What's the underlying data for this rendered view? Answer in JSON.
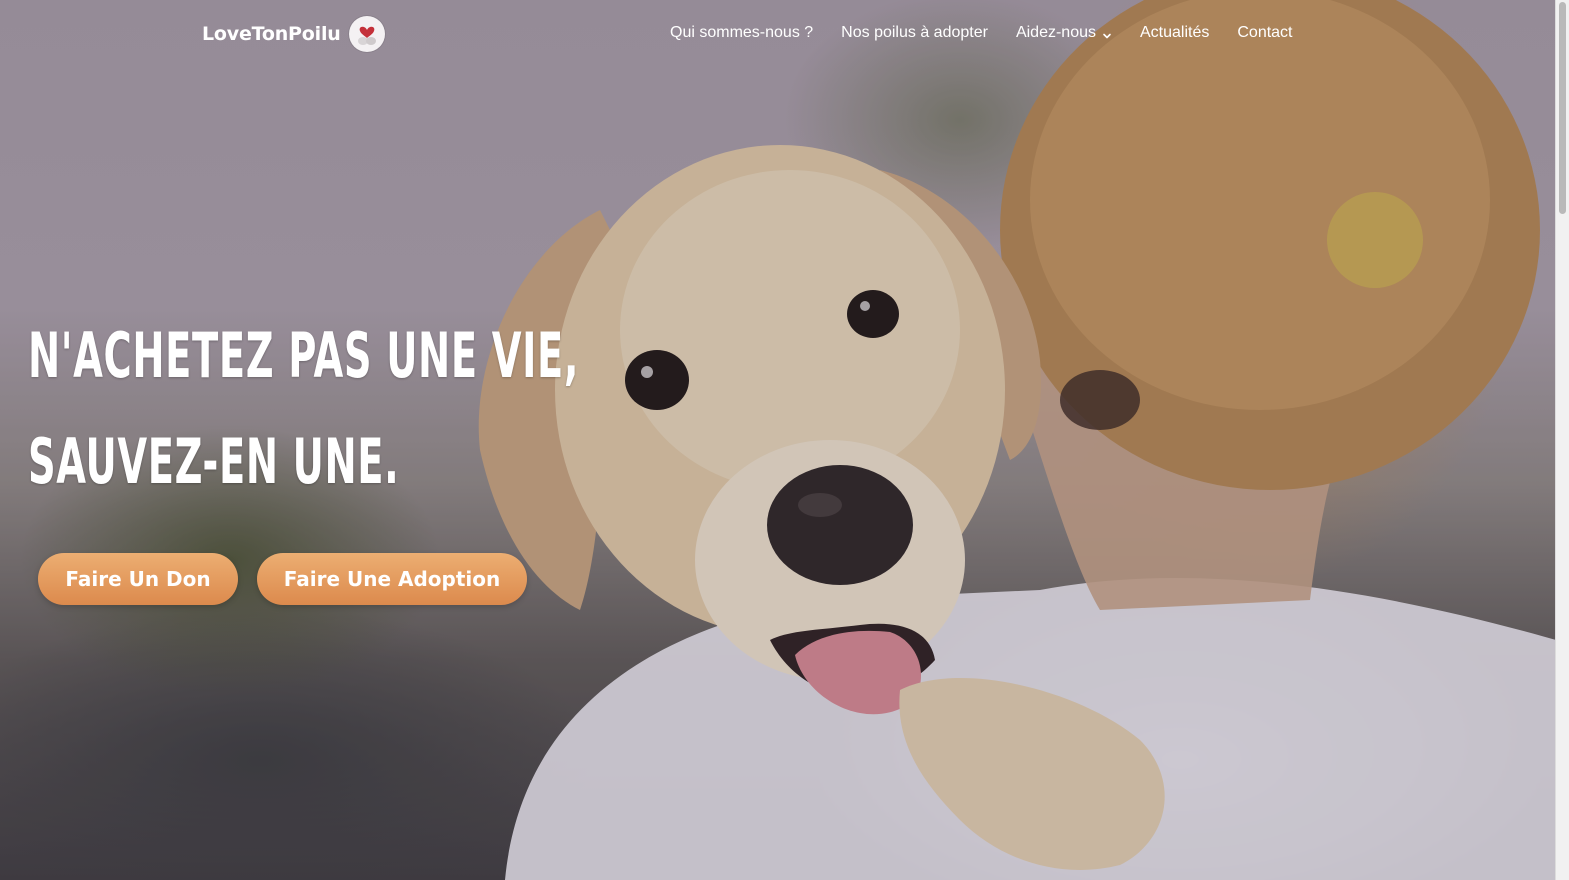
{
  "header": {
    "logo_text": "LoveTonPoilu",
    "logo_badge_icon": "heart-dog-icon",
    "nav": [
      {
        "label": "Qui sommes-nous ?",
        "has_dropdown": false
      },
      {
        "label": "Nos poilus à adopter",
        "has_dropdown": false
      },
      {
        "label": "Aidez-nous",
        "has_dropdown": true
      },
      {
        "label": "Actualités",
        "has_dropdown": false
      },
      {
        "label": "Contact",
        "has_dropdown": false
      }
    ]
  },
  "hero": {
    "headline_line1": "N'achetez pas une vie,",
    "headline_line2": "sauvez-en une.",
    "button_don": "Faire Un Don",
    "button_adoption": "Faire Une Adoption",
    "background_image": "puppy-on-shoulder-photo"
  },
  "colors": {
    "button_gradient_top": "#ecae72",
    "button_gradient_bottom": "#dc8a4d",
    "text": "#ffffff"
  }
}
